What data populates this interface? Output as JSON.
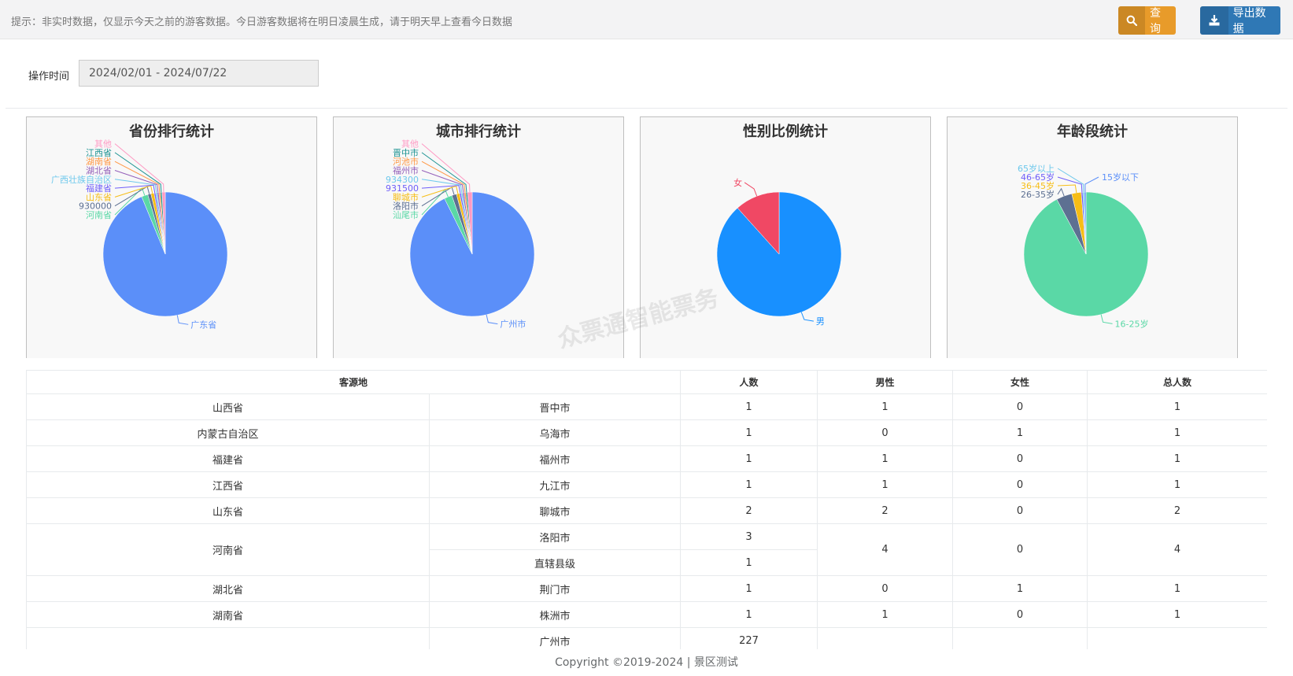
{
  "toolbar": {
    "tip": "提示：非实时数据，仅显示今天之前的游客数据。今日游客数据将在明日凌晨生成，请于明天早上查看今日数据",
    "query_label": "查询",
    "export_label": "导出数据"
  },
  "filter": {
    "label": "操作时间",
    "value": "2024/02/01 - 2024/07/22"
  },
  "watermark": "众票通智能票务",
  "chart_data": [
    {
      "type": "pie",
      "title": "省份排行统计",
      "labels": [
        "广东省",
        "河南省",
        "930000",
        "山东省",
        "福建省",
        "广西壮族自治区",
        "湖北省",
        "湖南省",
        "江西省",
        "其他"
      ],
      "values": [
        227,
        4,
        2,
        2,
        1,
        1,
        1,
        1,
        1,
        2
      ],
      "colors": [
        "#5b8ff9",
        "#5ad8a6",
        "#5d7092",
        "#f6bd16",
        "#6f5ef9",
        "#6dc8ec",
        "#945fb9",
        "#ff9845",
        "#1e9493",
        "#ff99c3"
      ]
    },
    {
      "type": "pie",
      "title": "城市排行统计",
      "labels": [
        "广州市",
        "汕尾市",
        "洛阳市",
        "聊城市",
        "931500",
        "934300",
        "福州市",
        "河池市",
        "晋中市",
        "其他"
      ],
      "values": [
        227,
        5,
        3,
        2,
        1,
        1,
        1,
        1,
        1,
        3
      ],
      "colors": [
        "#5b8ff9",
        "#5ad8a6",
        "#5d7092",
        "#f6bd16",
        "#6f5ef9",
        "#6dc8ec",
        "#945fb9",
        "#ff9845",
        "#1e9493",
        "#ff99c3"
      ]
    },
    {
      "type": "pie",
      "title": "性别比例统计",
      "labels": [
        "男",
        "女"
      ],
      "values": [
        212,
        28
      ],
      "colors": [
        "#1890ff",
        "#f04864"
      ]
    },
    {
      "type": "pie",
      "title": "年龄段统计",
      "labels": [
        "16-25岁",
        "26-35岁",
        "36-45岁",
        "46-65岁",
        "65岁以上",
        "15岁以下"
      ],
      "values": [
        225,
        10,
        6,
        1,
        1,
        1
      ],
      "colors": [
        "#5ad8a6",
        "#5d7092",
        "#f6bd16",
        "#6f5ef9",
        "#6dc8ec",
        "#5b8ff9"
      ]
    }
  ],
  "table": {
    "headers": [
      "客源地",
      "人数",
      "男性",
      "女性",
      "总人数"
    ],
    "rows": [
      {
        "province": "山西省",
        "cities": [
          {
            "city": "晋中市",
            "count": "1"
          }
        ],
        "male": "1",
        "female": "0",
        "total": "1"
      },
      {
        "province": "内蒙古自治区",
        "cities": [
          {
            "city": "乌海市",
            "count": "1"
          }
        ],
        "male": "0",
        "female": "1",
        "total": "1"
      },
      {
        "province": "福建省",
        "cities": [
          {
            "city": "福州市",
            "count": "1"
          }
        ],
        "male": "1",
        "female": "0",
        "total": "1"
      },
      {
        "province": "江西省",
        "cities": [
          {
            "city": "九江市",
            "count": "1"
          }
        ],
        "male": "1",
        "female": "0",
        "total": "1"
      },
      {
        "province": "山东省",
        "cities": [
          {
            "city": "聊城市",
            "count": "2"
          }
        ],
        "male": "2",
        "female": "0",
        "total": "2"
      },
      {
        "province": "河南省",
        "cities": [
          {
            "city": "洛阳市",
            "count": "3"
          },
          {
            "city": "直辖县级",
            "count": "1"
          }
        ],
        "male": "4",
        "female": "0",
        "total": "4"
      },
      {
        "province": "湖北省",
        "cities": [
          {
            "city": "荆门市",
            "count": "1"
          }
        ],
        "male": "0",
        "female": "1",
        "total": "1"
      },
      {
        "province": "湖南省",
        "cities": [
          {
            "city": "株洲市",
            "count": "1"
          }
        ],
        "male": "1",
        "female": "0",
        "total": "1"
      },
      {
        "province": "",
        "cities": [
          {
            "city": "广州市",
            "count": "227"
          },
          {
            "city": "",
            "count": ""
          }
        ],
        "male": "",
        "female": "",
        "total": ""
      }
    ]
  },
  "footer": {
    "copyright": "Copyright ©2019-2024 | 景区测试"
  }
}
